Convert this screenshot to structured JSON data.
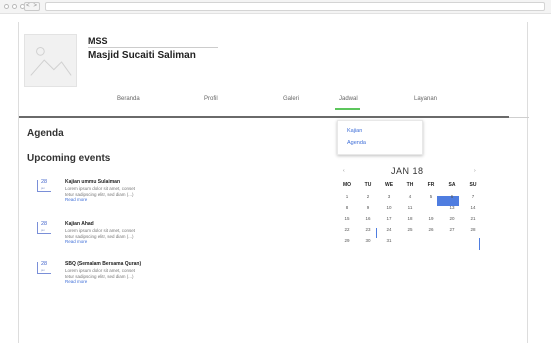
{
  "window": {
    "nav_buttons": "< >"
  },
  "site": {
    "abbr": "MSS",
    "name": "Masjid Sucaiti Saliman"
  },
  "nav": {
    "items": [
      "Beranda",
      "Profil",
      "Galeri",
      "Jadwal",
      "Layanan"
    ],
    "active": "Jadwal"
  },
  "dropdown": {
    "items": [
      "Kajian",
      "Agenda"
    ]
  },
  "headings": {
    "agenda": "Agenda",
    "upcoming": "Upcoming events"
  },
  "events": [
    {
      "day": "28",
      "month": "jan",
      "title": "Kajian ummu Sulaiman",
      "line1": "Lorem ipsum dolor sit amet, conset",
      "line2": "tetur sadipscing elitr, sed diam (...)",
      "more": "Read more"
    },
    {
      "day": "28",
      "month": "jan",
      "title": "Kajian Ahad",
      "line1": "Lorem ipsum dolor sit amet, conset",
      "line2": "tetur sadipscing elitr, sed diam (...)",
      "more": "Read more"
    },
    {
      "day": "28",
      "month": "jan",
      "title": "SBQ (Semalam Bersama Quran)",
      "line1": "Lorem ipsum dolor sit amet, conset",
      "line2": "tetur sadipscing elitr, sed diam (...)",
      "more": "Read more"
    }
  ],
  "calendar": {
    "prev": "‹",
    "next": "›",
    "title": "JAN 18",
    "weekdays": [
      "MO",
      "TU",
      "WE",
      "TH",
      "FR",
      "SA",
      "SU"
    ],
    "weeks": [
      [
        "1",
        "2",
        "3",
        "4",
        "5",
        "6",
        "7"
      ],
      [
        "8",
        "9",
        "10",
        "11",
        "12",
        "13",
        "14"
      ],
      [
        "15",
        "16",
        "17",
        "18",
        "19",
        "20",
        "21"
      ],
      [
        "22",
        "23",
        "24",
        "25",
        "26",
        "27",
        "28"
      ],
      [
        "29",
        "30",
        "31",
        "",
        "",
        "",
        ""
      ]
    ],
    "selected_day": "12"
  },
  "colors": {
    "accent": "#4f7de0",
    "active_nav": "#5cc65c",
    "link": "#3f6fd8"
  }
}
